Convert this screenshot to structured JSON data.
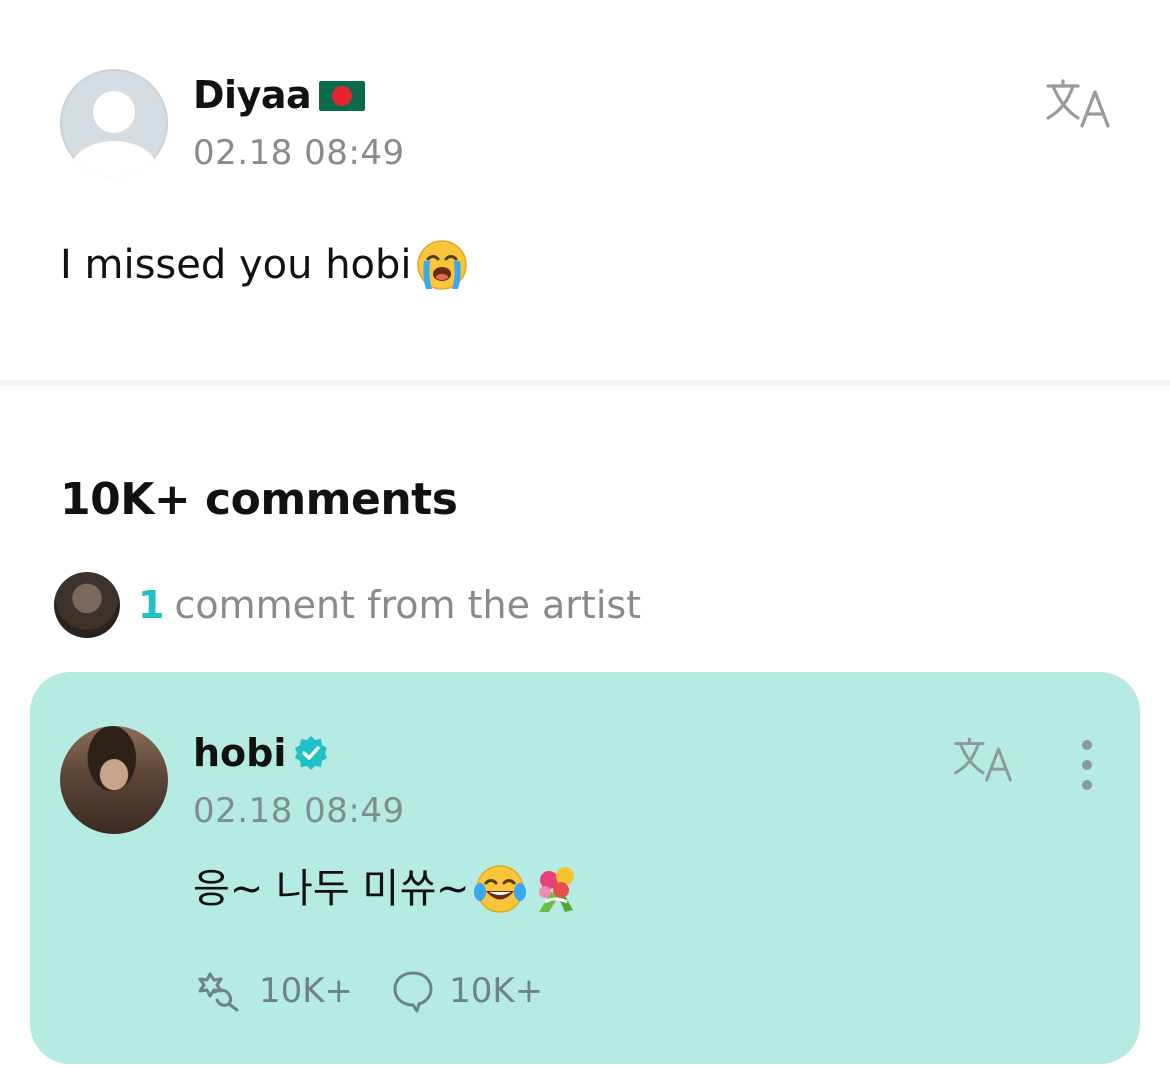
{
  "post": {
    "author": "Diyaa",
    "author_flag": "bangladesh-flag",
    "time": "02.18 08:49",
    "body": "I missed you hobi",
    "body_emoji": "loudly-crying-face"
  },
  "comments": {
    "title": "10K+ comments",
    "artist_summary": {
      "count": "1",
      "text": "comment from the artist"
    }
  },
  "artist_comment": {
    "name": "hobi",
    "verified": true,
    "time": "02.18 08:49",
    "body": "응~ 나두 미쓔~",
    "body_emojis": [
      "face-with-tears-of-joy",
      "bouquet"
    ],
    "likes": "10K+",
    "replies": "10K+"
  },
  "colors": {
    "card_bg": "#b5ebe2",
    "accent": "#21c0c6",
    "muted_text": "#8a8a8a",
    "divider": "#f4f5f6"
  }
}
